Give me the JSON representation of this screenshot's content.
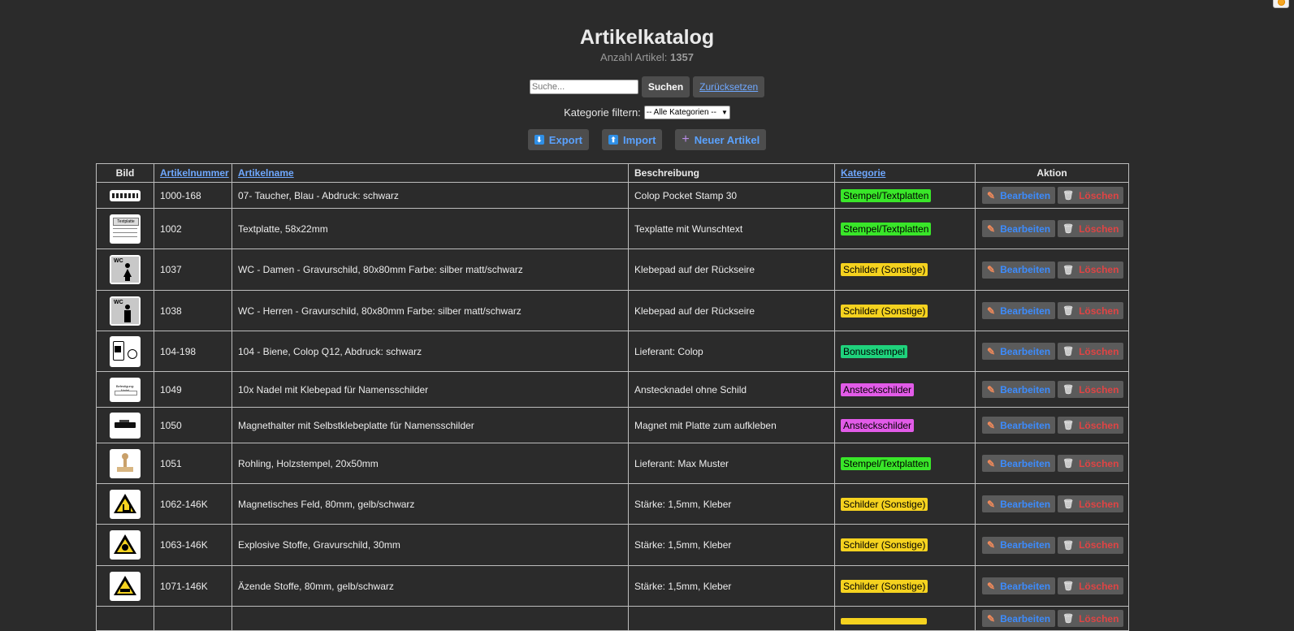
{
  "page": {
    "title": "Artikelkatalog",
    "count_label": "Anzahl Artikel:",
    "count_value": "1357"
  },
  "search": {
    "placeholder": "Suche...",
    "submit_label": "Suchen",
    "reset_label": "Zurücksetzen"
  },
  "filter": {
    "label": "Kategorie filtern:",
    "selected": "-- Alle Kategorien --"
  },
  "toolbar": {
    "export_label": "Export",
    "import_label": "Import",
    "new_label": "Neuer Artikel"
  },
  "table": {
    "headers": {
      "image": "Bild",
      "number": "Artikelnummer",
      "name": "Artikelname",
      "description": "Beschreibung",
      "category": "Kategorie",
      "action": "Aktion"
    },
    "edit_label": "Bearbeiten",
    "delete_label": "Löschen",
    "rows": [
      {
        "number": "1000-168",
        "name": "07- Taucher, Blau - Abdruck: schwarz",
        "description": "Colop Pocket Stamp 30",
        "category": "Stempel/Textplatten",
        "category_color": "#39e629"
      },
      {
        "number": "1002",
        "name": "Textplatte, 58x22mm",
        "description": "Texplatte mit Wunschtext",
        "category": "Stempel/Textplatten",
        "category_color": "#39e629"
      },
      {
        "number": "1037",
        "name": "WC - Damen - Gravurschild, 80x80mm Farbe: silber matt/schwarz",
        "description": "Klebepad auf der Rückseire",
        "category": "Schilder (Sonstige)",
        "category_color": "#f5d21f"
      },
      {
        "number": "1038",
        "name": "WC - Herren - Gravurschild, 80x80mm Farbe: silber matt/schwarz",
        "description": "Klebepad auf der Rückseire",
        "category": "Schilder (Sonstige)",
        "category_color": "#f5d21f"
      },
      {
        "number": "104-198",
        "name": "104 - Biene, Colop Q12, Abdruck: schwarz",
        "description": "Lieferant: Colop",
        "category": "Bonusstempel",
        "category_color": "#1fd27c"
      },
      {
        "number": "1049",
        "name": "10x Nadel mit Klebepad für Namensschilder",
        "description": "Anstecknadel ohne Schild",
        "category": "Ansteckschilder",
        "category_color": "#e25be8"
      },
      {
        "number": "1050",
        "name": "Magnethalter mit Selbstklebeplatte für Namensschilder",
        "description": "Magnet mit Platte zum aufkleben",
        "category": "Ansteckschilder",
        "category_color": "#e25be8"
      },
      {
        "number": "1051",
        "name": "Rohling, Holzstempel, 20x50mm",
        "description": "Lieferant: Max Muster",
        "category": "Stempel/Textplatten",
        "category_color": "#39e629"
      },
      {
        "number": "1062-146K",
        "name": "Magnetisches Feld, 80mm, gelb/schwarz",
        "description": "Stärke: 1,5mm, Kleber",
        "category": "Schilder (Sonstige)",
        "category_color": "#f5d21f"
      },
      {
        "number": "1063-146K",
        "name": "Explosive Stoffe, Gravurschild, 30mm",
        "description": "Stärke: 1,5mm, Kleber",
        "category": "Schilder (Sonstige)",
        "category_color": "#f5d21f"
      },
      {
        "number": "1071-146K",
        "name": "Äzende Stoffe, 80mm, gelb/schwarz",
        "description": "Stärke: 1,5mm, Kleber",
        "category": "Schilder (Sonstige)",
        "category_color": "#f5d21f"
      },
      {
        "number": "",
        "name": "",
        "description": "",
        "category": "",
        "category_color": "#f5d21f"
      }
    ]
  }
}
